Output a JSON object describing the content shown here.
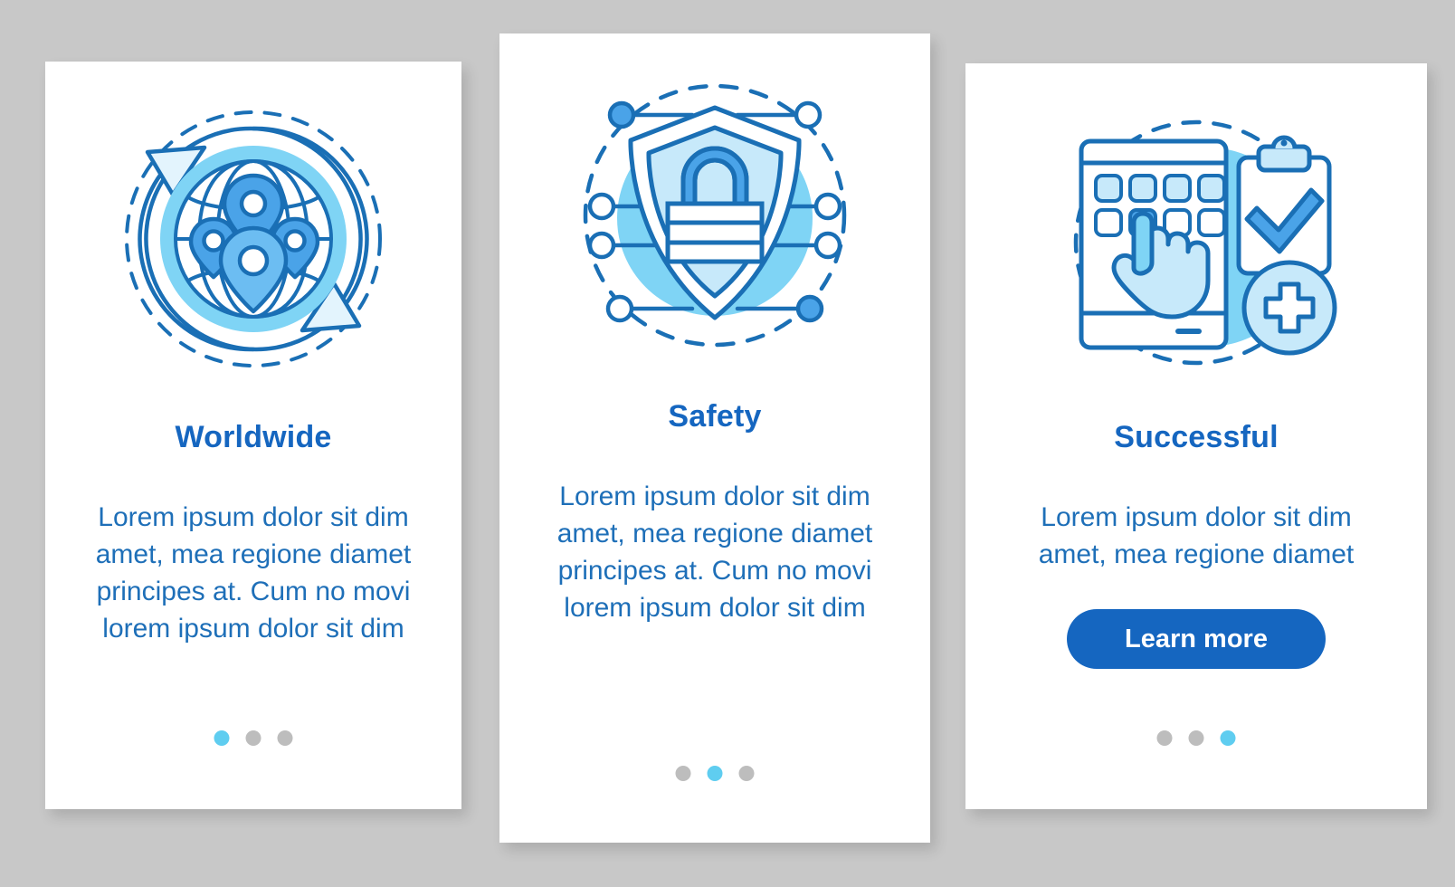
{
  "page": {
    "background_color": "#c8c8c8",
    "title_color": "#1566c0",
    "body_text_color": "#1e6fb8",
    "accent_color": "#1566c0",
    "dot_active_color": "#5fcdf0",
    "dot_inactive_color": "#bdbdbd"
  },
  "cards": [
    {
      "id": "worldwide",
      "icon": "globe-location-pins-icon",
      "title": "Worldwide",
      "description": "Lorem ipsum dolor sit dim amet, mea regione diamet principes at. Cum no movi lorem ipsum dolor sit dim",
      "has_button": false,
      "button_label": "",
      "dots": {
        "count": 3,
        "active_index": 0
      }
    },
    {
      "id": "safety",
      "icon": "shield-lock-network-icon",
      "title": "Safety",
      "description": "Lorem ipsum dolor sit dim amet, mea regione diamet principes at. Cum no movi lorem ipsum dolor sit dim",
      "has_button": false,
      "button_label": "",
      "dots": {
        "count": 3,
        "active_index": 1
      }
    },
    {
      "id": "successful",
      "icon": "smartphone-tap-clipboard-check-icon",
      "title": "Successful",
      "description": "Lorem ipsum dolor sit dim amet, mea regione diamet",
      "has_button": true,
      "button_label": "Learn more",
      "dots": {
        "count": 3,
        "active_index": 2
      }
    }
  ],
  "palette": {
    "outline_blue": "#1a6fb5",
    "mid_blue": "#4aa3e8",
    "light_blue": "#7fd4f5",
    "pale_blue": "#c7e9fa",
    "very_pale_blue": "#e3f4fd",
    "white": "#ffffff"
  }
}
